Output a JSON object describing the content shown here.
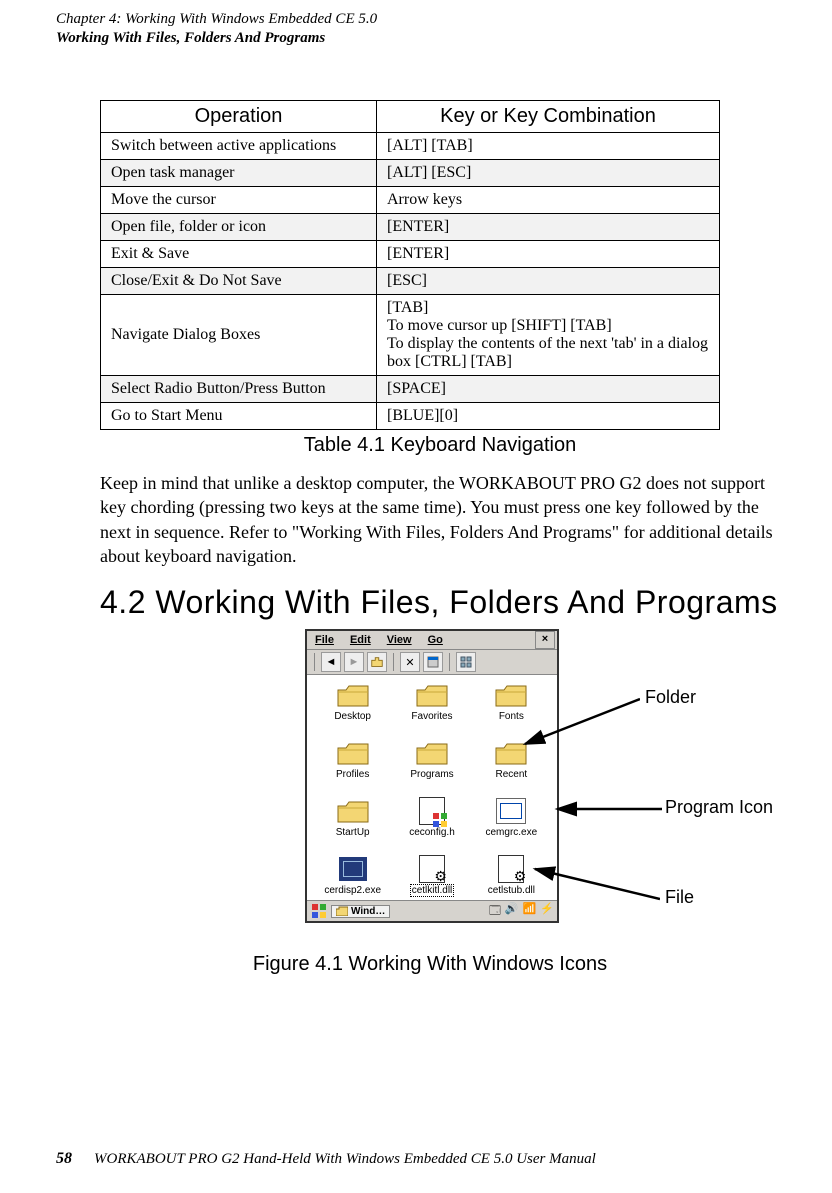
{
  "header": {
    "chapter": "Chapter 4:  Working With Windows Embedded CE 5.0",
    "section": "Working With Files, Folders And Programs"
  },
  "table": {
    "head_op": "Operation",
    "head_key": "Key or Key Combination",
    "rows": [
      {
        "op": "Switch between active applications",
        "key": "[ALT] [TAB]",
        "shade": false
      },
      {
        "op": "Open task manager",
        "key": "[ALT] [ESC]",
        "shade": true
      },
      {
        "op": "Move the cursor",
        "key": "Arrow keys",
        "shade": false
      },
      {
        "op": "Open file, folder or icon",
        "key": "[ENTER]",
        "shade": true
      },
      {
        "op": "Exit & Save",
        "key": "[ENTER]",
        "shade": false
      },
      {
        "op": "Close/Exit & Do Not Save",
        "key": "[ESC]",
        "shade": true
      },
      {
        "op": "Navigate Dialog Boxes",
        "key": "[TAB]\nTo move cursor up [SHIFT] [TAB]\nTo display the contents of the next 'tab' in a dialog box [CTRL] [TAB]",
        "shade": false
      },
      {
        "op": "Select Radio Button/Press Button",
        "key": "[SPACE]",
        "shade": true
      },
      {
        "op": "Go to Start Menu",
        "key": "[BLUE][0]",
        "shade": false
      }
    ],
    "caption": "Table 4.1   Keyboard Navigation"
  },
  "paragraph": "Keep in mind that unlike a desktop computer, the WORKABOUT PRO G2 does not support key chording (pressing two keys at the same time). You must press one key followed by the next in sequence. Refer to \"Working With Files, Folders And Programs\" for additional details about keyboard navigation.",
  "heading": "4.2  Working With Files, Folders And Programs",
  "screenshot": {
    "menu": {
      "file": "File",
      "edit": "Edit",
      "view": "View",
      "go": "Go"
    },
    "items": [
      {
        "type": "folder",
        "label": "Desktop"
      },
      {
        "type": "folder",
        "label": "Favorites"
      },
      {
        "type": "folder",
        "label": "Fonts"
      },
      {
        "type": "folder",
        "label": "Profiles"
      },
      {
        "type": "folder",
        "label": "Programs"
      },
      {
        "type": "folder",
        "label": "Recent"
      },
      {
        "type": "folder",
        "label": "StartUp"
      },
      {
        "type": "h",
        "label": "ceconfig.h"
      },
      {
        "type": "exe",
        "label": "cemgrc.exe"
      },
      {
        "type": "exe2",
        "label": "cerdisp2.exe"
      },
      {
        "type": "dll",
        "label": "cetlkitl.dll",
        "selected": true
      },
      {
        "type": "dll",
        "label": "cetlstub.dll"
      }
    ],
    "task_label": "Wind…",
    "annotations": {
      "folder": "Folder",
      "program": "Program Icon",
      "file": "File"
    }
  },
  "figure_caption": "Figure 4.1 Working With Windows Icons",
  "footer": {
    "page": "58",
    "text": "WORKABOUT PRO G2 Hand-Held With Windows Embedded CE 5.0 User Manual"
  }
}
